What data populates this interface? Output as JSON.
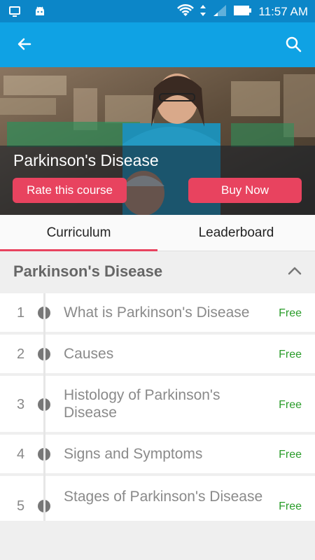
{
  "status_bar": {
    "time": "11:57 AM"
  },
  "app_bar": {
    "back_icon": "arrow-left-icon",
    "search_icon": "search-icon"
  },
  "hero": {
    "course_title": "Parkinson's Disease",
    "rate_button": "Rate this course",
    "buy_button": "Buy Now"
  },
  "tabs": [
    {
      "label": "Curriculum",
      "selected": true
    },
    {
      "label": "Leaderboard",
      "selected": false
    }
  ],
  "section": {
    "title": "Parkinson's Disease",
    "expanded": true
  },
  "lessons": [
    {
      "number": "1",
      "title": "What is Parkinson's Disease",
      "price": "Free"
    },
    {
      "number": "2",
      "title": "Causes",
      "price": "Free"
    },
    {
      "number": "3",
      "title": "Histology of Parkinson's Disease",
      "price": "Free"
    },
    {
      "number": "4",
      "title": "Signs and Symptoms",
      "price": "Free"
    },
    {
      "number": "5",
      "title": "Stages of Parkinson's Disease",
      "price": "Free"
    }
  ],
  "colors": {
    "status_bar": "#0c86c8",
    "app_bar": "#0fa2e4",
    "accent": "#e8435f",
    "free_text": "#2a9c2a"
  }
}
